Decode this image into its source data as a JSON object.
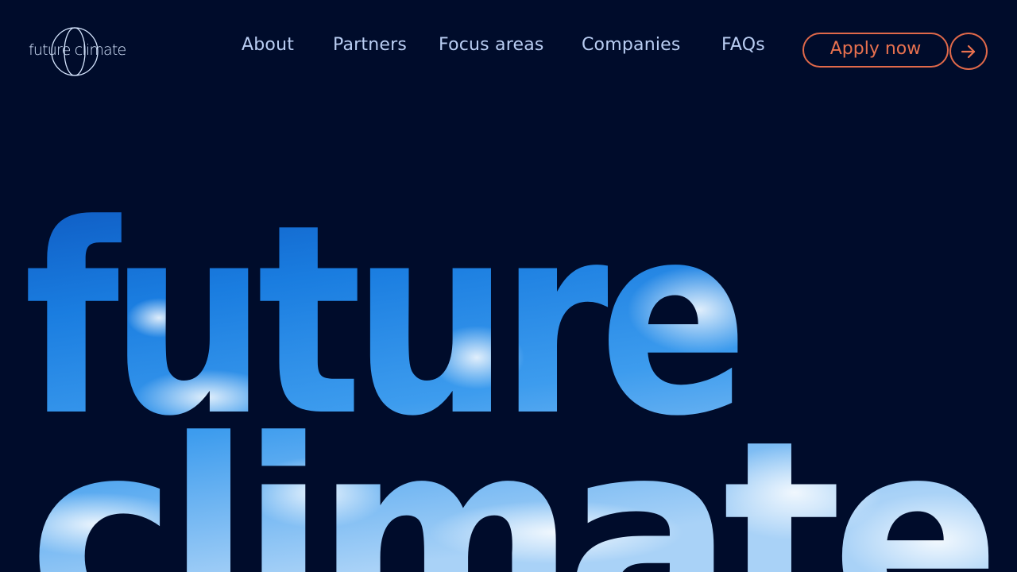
{
  "brand": {
    "logo_text": "future climate",
    "logo_icon": "globe-icon"
  },
  "nav": {
    "items": [
      {
        "label": "About"
      },
      {
        "label": "Partners"
      },
      {
        "label": "Focus areas"
      },
      {
        "label": "Companies"
      },
      {
        "label": "FAQs"
      }
    ]
  },
  "cta": {
    "apply_label": "Apply now",
    "arrow_icon": "arrow-right-icon"
  },
  "hero": {
    "line1": "future",
    "line2": "climate",
    "fill": "sky-with-clouds"
  },
  "colors": {
    "background": "#000c2b",
    "nav_text": "#b9cdf2",
    "accent": "#e0694a",
    "logo": "#d6e6ff",
    "sky_top": "#0a5bc4",
    "sky_mid": "#1f86e6",
    "sky_light": "#cfe6fb"
  }
}
